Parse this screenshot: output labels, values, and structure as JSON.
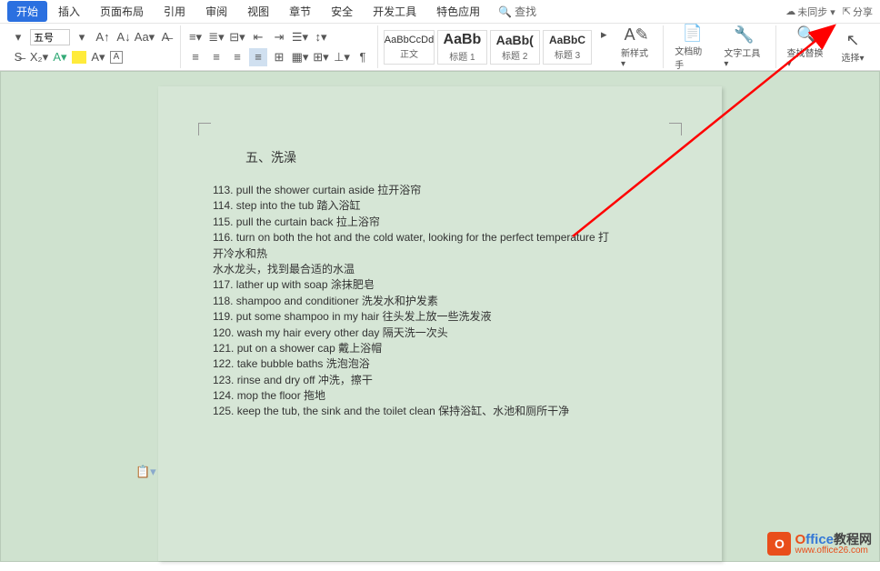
{
  "menubar": {
    "tabs": [
      "开始",
      "插入",
      "页面布局",
      "引用",
      "审阅",
      "视图",
      "章节",
      "安全",
      "开发工具",
      "特色应用"
    ],
    "active": 0,
    "search": "查找",
    "unsync": "未同步 ▾",
    "share": "分享"
  },
  "toolbar": {
    "font_size": "五号",
    "styles": [
      {
        "preview": "AaBbCcDd",
        "label": "正文",
        "cls": ""
      },
      {
        "preview": "AaBb",
        "label": "标题 1",
        "cls": "big"
      },
      {
        "preview": "AaBb(",
        "label": "标题 2",
        "cls": "med"
      },
      {
        "preview": "AaBbC",
        "label": "标题 3",
        "cls": "sm"
      }
    ],
    "new_style": "新样式▾",
    "doc_helper": "文档助手",
    "text_tools": "文字工具▾",
    "find_replace": "查找替换▾",
    "select": "选择▾"
  },
  "document": {
    "title": "五、洗澡",
    "lines": [
      "113. pull the shower curtain aside  拉开浴帘",
      "114. step into the tub  踏入浴缸",
      "115. pull the curtain back  拉上浴帘",
      "116. turn on both the hot and the cold water, looking for the perfect temperature  打",
      "开冷水和热",
      "水水龙头，找到最合适的水温",
      "117. lather up with soap  涂抹肥皂",
      "118. shampoo and conditioner  洗发水和护发素",
      "119. put some shampoo in my hair  往头发上放一些洗发液",
      "120. wash my hair every other day  隔天洗一次头",
      "121. put on a shower cap  戴上浴帽",
      "122. take bubble baths  洗泡泡浴",
      "123. rinse and dry off  冲洗，擦干",
      "124. mop the floor  拖地",
      "125. keep the tub, the sink and the toilet clean  保持浴缸、水池和厕所干净"
    ]
  },
  "watermark": {
    "brand1": "Office",
    "brand2": "教程网",
    "url": "www.office26.com"
  }
}
